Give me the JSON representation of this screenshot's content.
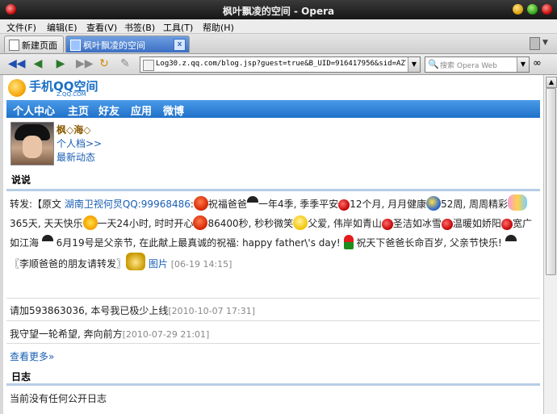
{
  "window": {
    "title": "枫叶飘凌的空间 - Opera"
  },
  "menu": [
    "文件(F)",
    "编辑(E)",
    "查看(V)",
    "书签(B)",
    "工具(T)",
    "帮助(H)"
  ],
  "tabs": [
    {
      "label": "新建页面"
    },
    {
      "label": "枫叶飘凌的空间",
      "close": "x"
    }
  ],
  "address": {
    "url": "Log30.z.qq.com/blog.jsp?guest=true&B_UID=916417956&sid=AZYfC"
  },
  "search": {
    "placeholder": "搜索 Opera Web"
  },
  "site": {
    "logo_text": "手机QQ空间",
    "logo_sub": "Z.QQ.COM",
    "nav": [
      "个人中心",
      "主页",
      "好友",
      "应用",
      "微博"
    ]
  },
  "profile": {
    "name": "枫◇海◇",
    "link_profile": "个人档>>",
    "link_news": "最新动态"
  },
  "shuoshuo": {
    "heading": "说说",
    "post1": {
      "prefix": "转发:【原文 ",
      "author": "湖南卫视何炅QQ:",
      "qq": "99968486",
      "t1": ":",
      "t2": "祝福爸爸",
      "t3": "一年4季, 季季平安",
      "t4": "12个月, 月月健康",
      "t5": "52周, 周周精彩",
      "t6": "365天, 天天快乐",
      "t7": "一天24小时, 时时开心",
      "t8": "86400秒, 秒秒微笑",
      "t9": "父爱, 伟岸如青山",
      "t10": "圣洁如冰雪",
      "t11": "温暖如娇阳",
      "t12": "宽广如江海",
      "t13": "6月19号是父亲节, 在此献上最真诚的祝福: happy father\\'s day!",
      "t14": "祝天下爸爸长命百岁, 父亲节快乐!",
      "t15": "〖李顺爸爸的朋友请转发〗",
      "pic": "图片",
      "time": "[06-19 14:15]"
    },
    "post2": {
      "text": "请加593863036, 本号我已极少上线",
      "time": "[2010-10-07 17:31]"
    },
    "post3": {
      "text": "我守望一轮希望, 奔向前方",
      "time": "[2010-07-29 21:01]"
    },
    "more": "查看更多»"
  },
  "diary": {
    "heading": "日志",
    "empty": "当前没有任何公开日志"
  }
}
